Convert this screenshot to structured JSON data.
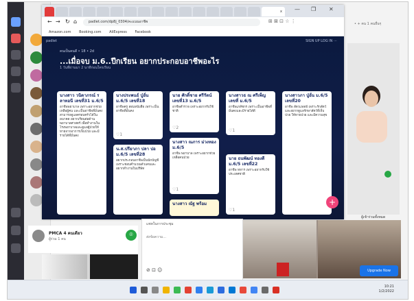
{
  "browser": {
    "tabs": [
      "",
      "",
      "",
      "",
      "",
      "",
      "",
      "",
      "",
      "",
      "",
      "",
      "",
      "",
      "",
      "",
      "",
      ""
    ],
    "active_tab_close": "x",
    "url": "padlet.com/dp8j_0304/คะแนนอาชีพ",
    "bookmarks": [
      "Amazon.com",
      "Booking.com",
      "AliExpress",
      "Facebook"
    ],
    "window_controls": [
      "—",
      "❐",
      "✕"
    ]
  },
  "padlet": {
    "top_left": "padlet",
    "top_right": "SIGN UP   LOG IN   ⋯",
    "owner": "คนเป็นคนดี • 18 • 2d",
    "title": "...เมื่อจบ ม.6..ปีกเรียน อยากประกอบอาชีพอะไร",
    "subtitle": "1 วันที่ผ่านมา 2 นาทีก่อนใครเรียน",
    "columns": [
      [
        {
          "title": "นางสาว วนิดาภรณ์ รลาทอนี เลขที่31 ม.6/5",
          "body": "อาชีพพยาบาล เพราะอยากช่วยเหลือผู้คน และเป็นอาชีพที่มั่นคง สามารถดูแลครอบครัวได้ในอนาคต อยากเรียนต่อด้านพยาบาลศาสตร์ เพื่อทำงานในโรงพยาบาลและดูแลผู้ป่วยให้หายจากอาการเจ็บป่วย และมีรายได้ที่มั่นคง",
          "likes": ""
        }
      ],
      [
        {
          "title": "นางประพนธ์ ปู่อั่น ม.6/5 เลขที่18",
          "body": "อาชีพครู สอนหนังสือ เพราะเป็นอาชีพที่มั่นคง",
          "likes": "♡1"
        },
        {
          "title": "น.ส.ปรียาภา ปลา ปอ ม.6/5 เลขที่28",
          "body": "อยากประกอบอาชีพเป็นนักบัญชี เพราะชอบคำนวณตัวเลขและอยากทำงานในบริษัท",
          "likes": ""
        }
      ],
      [
        {
          "title": "นาย ศักดิ์ชาย ศรีรัตน์ เลขที่13 ม.6/5",
          "body": "อาชีพตำรวจ เพราะอยากรับใช้ชาติ",
          "likes": "♡2"
        },
        {
          "title": "นางสาว ณภาร ม่วงทอง ม.6/5",
          "body": "อาชีพ พยาบาล เพราะอยากช่วยเหลือคนป่วย",
          "likes": "♡1"
        },
        {
          "title": "นางสาว ณัฐ พร้อม",
          "body": "",
          "likes": ""
        }
      ],
      [
        {
          "title": "นางสาวธ ณ ศรีเพ็ญ เลขที่ ม.6/5",
          "body": "อาชีพเภสัชกร เพราะเป็นอาชีพที่มั่นคงและมีรายได้ดี",
          "likes": "♡1"
        },
        {
          "title": "นาย ธนพัฒน์ ทองดี ม.6/5 เลขที่22",
          "body": "อาชีพ ทหาร เพราะอยากรับใช้ประเทศชาติ",
          "likes": "♡1"
        }
      ],
      [
        {
          "title": "นางสาวภา ปู่อั่น ม.6/5 เลขที่20",
          "body": "อาชีพ สัตวแพทย์ เพราะรักสัตว์และอยากดูแลรักษาสัตว์ที่เจ็บป่วย ให้หายป่วย และมีความสุข",
          "likes": ""
        }
      ]
    ],
    "fab": "+"
  },
  "right_panel": {
    "label": "• + คน    1 คนอื่นๆ"
  },
  "video": {
    "name": "ผู้เข้าร่วมทั้งหมด"
  },
  "chat": {
    "title": "แชทในการประชุม",
    "placeholder": "ส่งข้อความ...",
    "icons": "⊘ ⊡ ☺"
  },
  "participant": {
    "name": "PMCA 4 คนเดียว",
    "status": "ผู้ร่วม 1 คน",
    "call_icon": "⌾"
  },
  "upgrade": "Upgrade Now",
  "taskbar": {
    "time": "10:21",
    "date": "1/2/2022"
  },
  "colors": {
    "padlet_bg": "#0f1c46",
    "fab": "#f0447a",
    "upgrade": "#1a73e8",
    "call": "#27a745"
  }
}
